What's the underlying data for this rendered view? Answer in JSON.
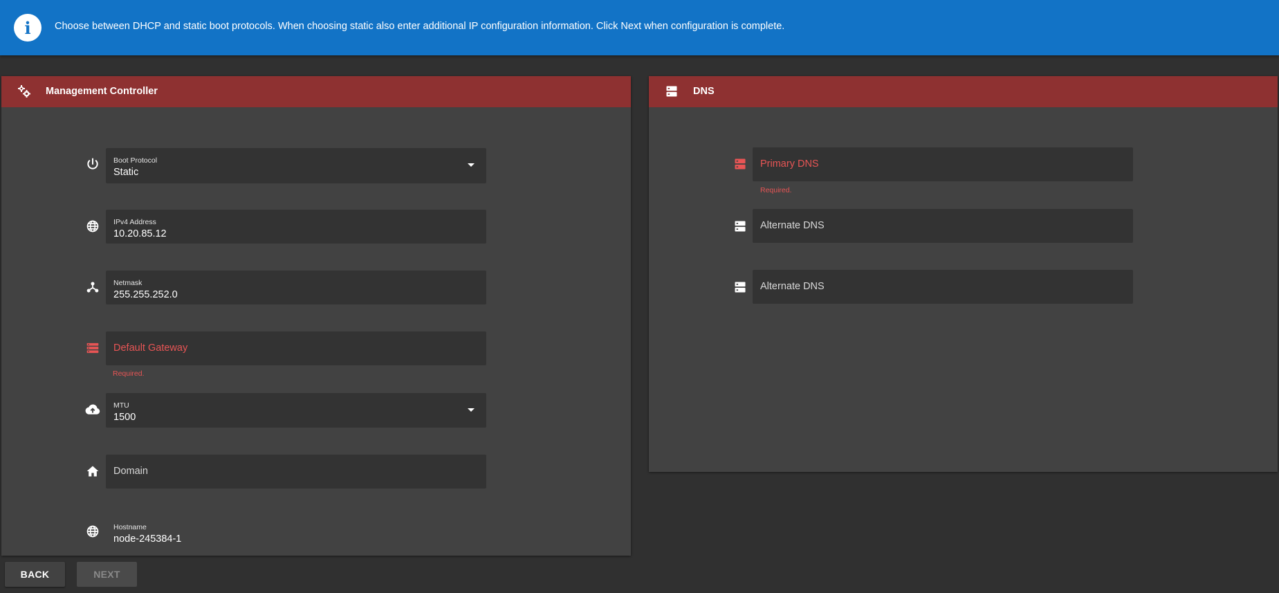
{
  "banner": {
    "icon": "info-icon",
    "message": "Choose between DHCP and static boot protocols. When choosing static also enter additional IP configuration information. Click Next when configuration is complete."
  },
  "management": {
    "title": "Management Controller",
    "icon": "gears-icon",
    "fields": {
      "boot_protocol": {
        "label": "Boot Protocol",
        "value": "Static",
        "icon": "power-icon"
      },
      "ipv4": {
        "label": "IPv4 Address",
        "value": "10.20.85.12",
        "icon": "globe-icon"
      },
      "netmask": {
        "label": "Netmask",
        "value": "255.255.252.0",
        "icon": "network-icon"
      },
      "gateway": {
        "placeholder": "Default Gateway",
        "error": "Required.",
        "icon": "server-list-icon"
      },
      "mtu": {
        "label": "MTU",
        "value": "1500",
        "icon": "cloud-upload-icon"
      },
      "domain": {
        "placeholder": "Domain",
        "icon": "home-icon"
      },
      "hostname": {
        "label": "Hostname",
        "value": "node-245384-1",
        "icon": "globe-icon"
      }
    }
  },
  "dns": {
    "title": "DNS",
    "icon": "dns-icon",
    "fields": {
      "primary": {
        "placeholder": "Primary DNS",
        "error": "Required.",
        "icon": "dns-icon"
      },
      "alternate1": {
        "placeholder": "Alternate DNS",
        "icon": "dns-icon"
      },
      "alternate2": {
        "placeholder": "Alternate DNS",
        "icon": "dns-icon"
      }
    }
  },
  "buttons": {
    "back": "BACK",
    "next": "NEXT"
  },
  "colors": {
    "banner": "#1273c6",
    "card_header": "#8e3131",
    "error": "#e85555",
    "background": "#303030",
    "card": "#424242",
    "field": "#333333"
  }
}
